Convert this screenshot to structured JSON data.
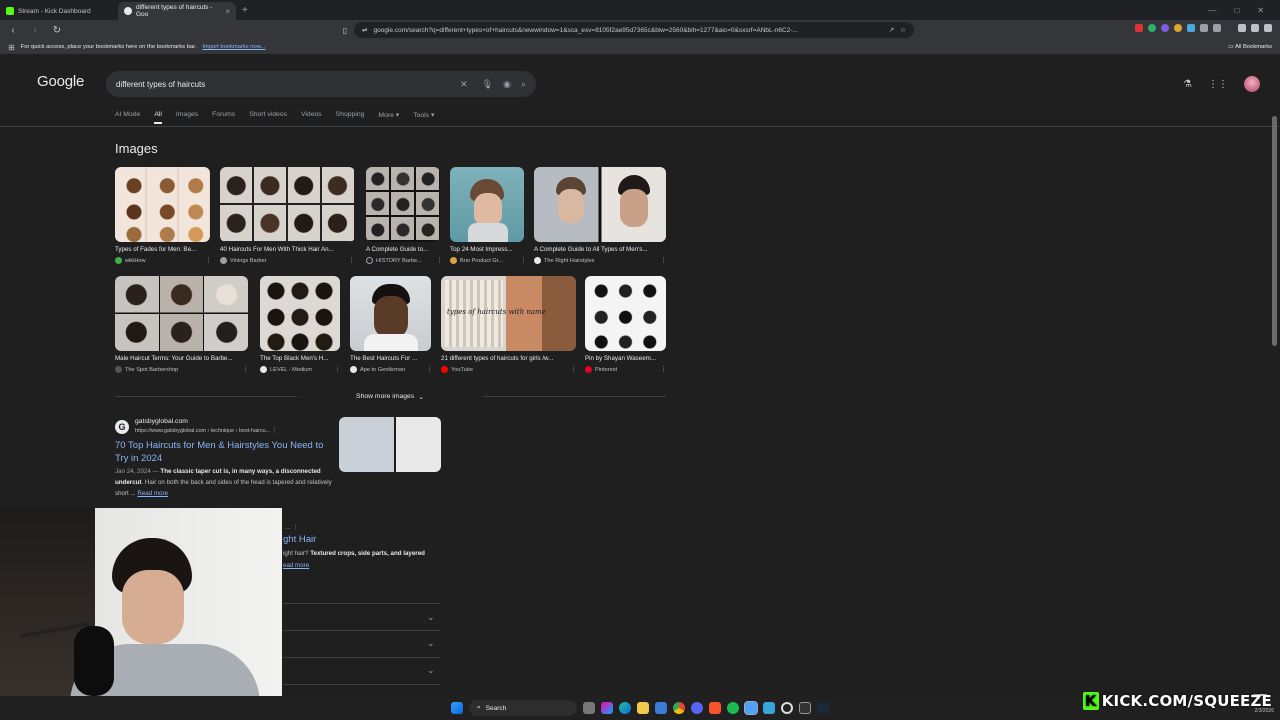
{
  "browser": {
    "tabs": [
      {
        "title": "Stream - Kick Dashboard",
        "favicon_color": "#53fc18"
      },
      {
        "title": "different types of haircuts - Goo",
        "favicon_color": "#e8eaed"
      }
    ],
    "new_tab": "+",
    "close": "×",
    "address": "google.com/search?q=different+types+of+haircuts&newwindow=1&sca_esv=8105f2ae95d7365c&biw=2560&bih=1277&aic=0&sxsrf=ANbL-n6C2-...",
    "bookmarks_hint": "For quick access, place your bookmarks here on the bookmarks bar.",
    "bookmarks_link": "Import bookmarks now...",
    "all_bookmarks": "All Bookmarks"
  },
  "google": {
    "logo": "Google",
    "query": "different types of haircuts",
    "tabs": [
      "AI Mode",
      "All",
      "Images",
      "Forums",
      "Short videos",
      "Videos",
      "Shopping",
      "More",
      "Tools"
    ],
    "images_heading": "Images",
    "images": [
      {
        "caption": "Types of Fades for Men: Be...",
        "source": "wikiHow",
        "dot": "#3bb34a"
      },
      {
        "caption": "40 Haircuts For Men With Thick Hair An...",
        "source": "Vinings Barber",
        "dot": "#9aa0a6"
      },
      {
        "caption": "A Complete Guide to...",
        "source": "HISTORY Barbe...",
        "dot": "#202124"
      },
      {
        "caption": "Top 24 Most Impress...",
        "source": "Brio Product Gr...",
        "dot": "#d9a441"
      },
      {
        "caption": "A Complete Guide to All Types of Men's...",
        "source": "The Right Hairstyles",
        "dot": "#e8eaed"
      },
      {
        "caption": "Male Haircut Terms: Your Guide to Barbe...",
        "source": "The Spot Barbershop",
        "dot": "#555555"
      },
      {
        "caption": "The Top Black Men's H...",
        "source": "LEVEL - Medium",
        "dot": "#e8eaed"
      },
      {
        "caption": "The Best Haircuts For ...",
        "source": "Ape to Gentleman",
        "dot": "#e8eaed"
      },
      {
        "caption": "21 different types of haircuts for girls /w...",
        "source": "YouTube",
        "dot": "#ff0000"
      },
      {
        "caption": "Pin by Shayan Waseem...",
        "source": "Pinterest",
        "dot": "#e60023"
      }
    ],
    "thumb_overlay_text": "types of haircuts with name",
    "show_more": "Show more images",
    "result1": {
      "favicon": "G",
      "site": "gatsbyglobal.com",
      "url": "https://www.gatsbyglobal.com › technique › best-haircu...",
      "title": "70 Top Haircuts for Men & Hairstyles You Need to Try in 2024",
      "date": "Jan 24, 2024 —",
      "snippet_bold1": "The classic taper cut is, in many ways, a disconnected undercut",
      "snippet_rest": ". Hair on both the back and sides of the head is tapered and relatively short ...",
      "read_more": "Read more"
    },
    "result2": {
      "title_fragment": "ght Hair",
      "snippet_start": "ight hair? ",
      "snippet_bold": "Textured crops, side parts, and layered",
      "read_more": "ead more"
    }
  },
  "taskbar": {
    "search": "Search",
    "icons": [
      "windows-icon",
      "search-icon",
      "taskview-icon",
      "copilot-icon",
      "edge-icon",
      "explorer-icon",
      "store-icon",
      "chrome-icon",
      "discord-icon",
      "brave-icon",
      "spotify-icon",
      "notepad-icon",
      "app-icon",
      "obs-icon",
      "terminal-icon",
      "steam-icon"
    ]
  },
  "overlay": {
    "kick_k": "K",
    "kick_text": "KICK.COM/SQUEEZE",
    "date": "2/3/2026"
  }
}
